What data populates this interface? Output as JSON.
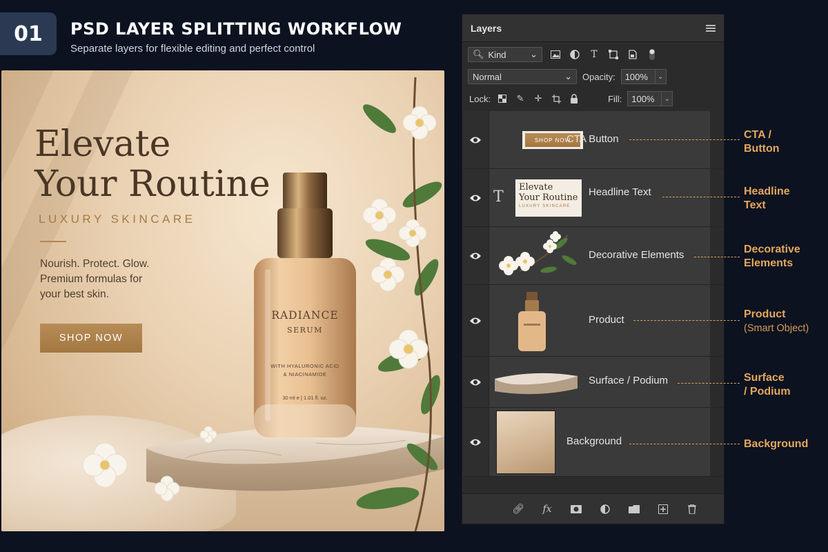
{
  "header": {
    "step": "01",
    "title": "PSD LAYER SPLITTING WORKFLOW",
    "subtitle": "Separate layers for flexible editing and perfect control"
  },
  "ad": {
    "headline_line1": "Elevate",
    "headline_line2": "Your Routine",
    "tagline": "LUXURY SKINCARE",
    "copy_line1": "Nourish. Protect. Glow.",
    "copy_line2": "Premium formulas for",
    "copy_line3": "your best skin.",
    "cta": "SHOP NOW",
    "bottle": {
      "brand": "RADIANCE",
      "product": "SERUM",
      "ingredients_line1": "WITH HYALURONIC ACID",
      "ingredients_line2": "& NIACINAMIDE",
      "volume": "30 ml e | 1.01 fl. oz."
    }
  },
  "panel": {
    "title": "Layers",
    "kind_label": "Kind",
    "blend_mode": "Normal",
    "opacity_label": "Opacity:",
    "opacity_value": "100%",
    "lock_label": "Lock:",
    "fill_label": "Fill:",
    "fill_value": "100%",
    "layers": [
      {
        "name": "CTA Button",
        "thumb_text": "SHOP NOW"
      },
      {
        "name": "Headline Text",
        "thumb_line1": "Elevate",
        "thumb_line2": "Your Routine",
        "thumb_line3": "LUXURY SKINCARE"
      },
      {
        "name": "Decorative Elements"
      },
      {
        "name": "Product"
      },
      {
        "name": "Surface / Podium"
      },
      {
        "name": "Background"
      }
    ]
  },
  "callouts": [
    {
      "line1": "CTA /",
      "line2": "Button"
    },
    {
      "line1": "Headline",
      "line2": "Text"
    },
    {
      "line1": "Decorative",
      "line2": "Elements"
    },
    {
      "line1": "Product",
      "sub": "(Smart Object)"
    },
    {
      "line1": "Surface",
      "line2": "/ Podium"
    },
    {
      "line1": "Background"
    }
  ],
  "colors": {
    "page_bg": "#0c1220",
    "accent_gold": "#e4a75c",
    "panel_bg": "#2b2b2b",
    "cta_gold": "#b08248"
  }
}
